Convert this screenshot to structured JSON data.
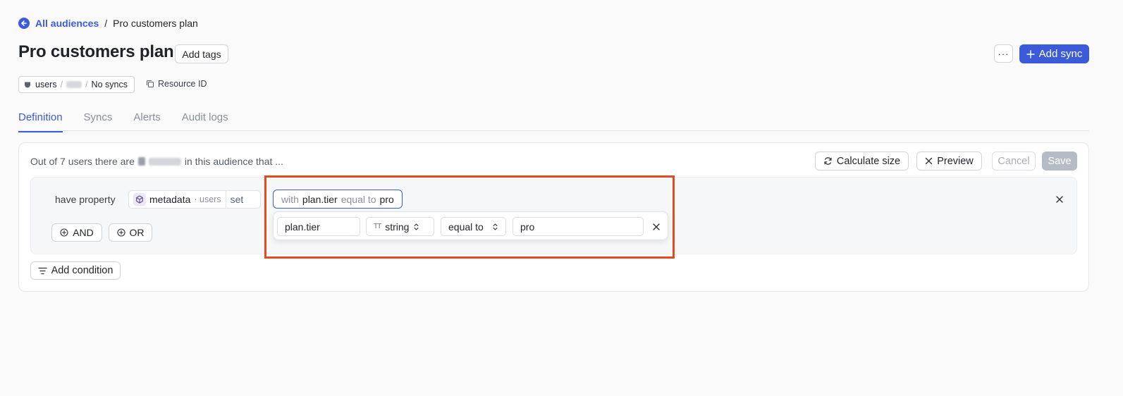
{
  "breadcrumb": {
    "back_link": "All audiences",
    "separator": "/",
    "current": "Pro customers plan"
  },
  "header": {
    "title": "Pro customers plan",
    "add_tags": "Add tags",
    "more": "···",
    "add_sync": "Add sync"
  },
  "meta": {
    "source": "users",
    "sep": "/",
    "syncs": "No syncs",
    "resource_id": "Resource ID"
  },
  "tabs": [
    {
      "label": "Definition",
      "active": true
    },
    {
      "label": "Syncs",
      "active": false
    },
    {
      "label": "Alerts",
      "active": false
    },
    {
      "label": "Audit logs",
      "active": false
    }
  ],
  "summary": {
    "prefix": "Out of 7 users there are",
    "suffix": "in this audience that ..."
  },
  "actions": {
    "calculate": "Calculate size",
    "preview": "Preview",
    "cancel": "Cancel",
    "save": "Save"
  },
  "condition": {
    "label": "have property",
    "property": "metadata",
    "model": "· users",
    "mode": "set",
    "and": "AND",
    "or": "OR"
  },
  "add_condition": "Add condition",
  "filter_pill": {
    "with": "with",
    "property": "plan.tier",
    "op": "equal to",
    "value": "pro"
  },
  "filter_editor": {
    "property": "plan.tier",
    "type_glyph": "TT",
    "type": "string",
    "operator": "equal to",
    "value": "pro"
  },
  "colors": {
    "accent": "#3b5bdb",
    "highlight": "#e34a20"
  }
}
